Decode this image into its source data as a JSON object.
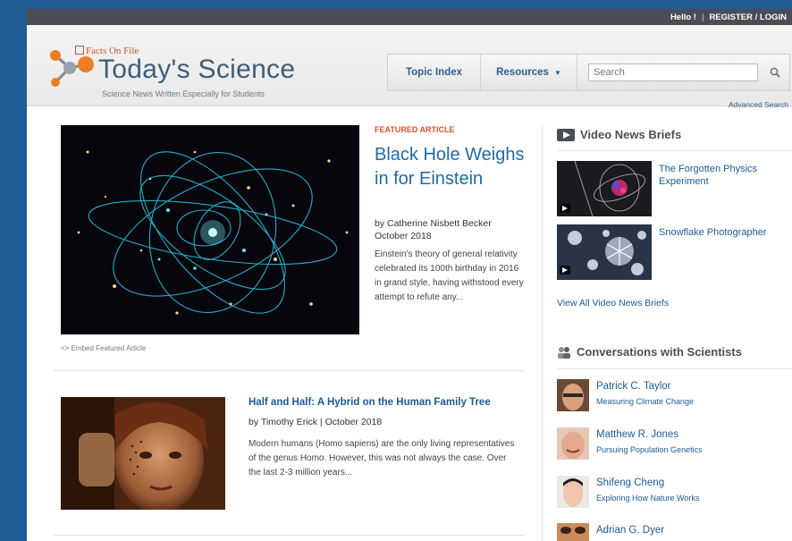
{
  "topbar": {
    "greeting": "Hello !",
    "separator": "|",
    "register_login": "REGISTER / LOGIN"
  },
  "brand": {
    "publisher": "Facts On File",
    "title": "Today's Science",
    "tagline": "Science News Written Especially for Students"
  },
  "nav": {
    "topic_index": "Topic Index",
    "resources": "Resources",
    "search_placeholder": "Search",
    "advanced_search": "Advanced Search"
  },
  "featured": {
    "label": "FEATURED ARTICLE",
    "title": "Black Hole Weighs in for Einstein",
    "author": "by Catherine Nisbett Becker",
    "date": "October 2018",
    "summary": "Einstein's theory of general relativity celebrated its 100th birthday in 2016 in grand style, having withstood every attempt to refute any...",
    "embed": "<> Embed Featured Article"
  },
  "article2": {
    "title": "Half and Half: A Hybrid on the Human Family Tree",
    "byline": "by Timothy Erick | October 2018",
    "summary": "Modern humans (Homo sapiens) are the only living representatives of the genus Homo. However, this was not always the case. Over the last 2-3 million years..."
  },
  "video_section": {
    "title": "Video News Briefs",
    "items": [
      {
        "title": "The Forgotten Physics Experiment"
      },
      {
        "title": "Snowflake Photographer"
      }
    ],
    "view_all": "View All Video News Briefs"
  },
  "conversations": {
    "title": "Conversations with Scientists",
    "items": [
      {
        "name": "Patrick C. Taylor",
        "topic": "Measuring Climate Change"
      },
      {
        "name": "Matthew R. Jones",
        "topic": "Pursuing Population Genetics"
      },
      {
        "name": "Shifeng Cheng",
        "topic": "Exploring How Nature Works"
      },
      {
        "name": "Adrian G. Dyer",
        "topic": ""
      }
    ]
  },
  "colors": {
    "brand_blue": "#1f6aa5",
    "accent_orange": "#d9512c",
    "topbar": "#4a4e54",
    "background": "#1f5c94"
  },
  "icons": [
    "molecule-logo-icon",
    "search-icon",
    "caret-down-icon",
    "video-icon",
    "people-icon",
    "play-icon"
  ]
}
